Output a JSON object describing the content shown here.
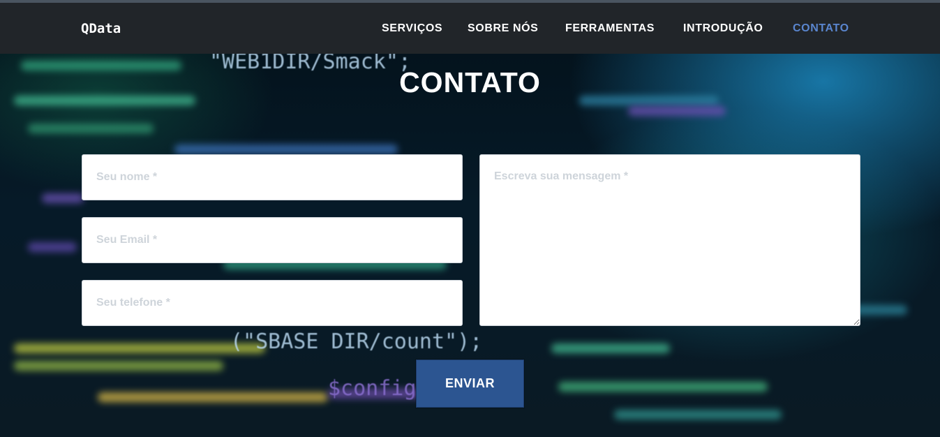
{
  "nav": {
    "brand": "QData",
    "links": [
      {
        "label": "SERVIÇOS"
      },
      {
        "label": "SOBRE NÓS"
      },
      {
        "label": "FERRAMENTAS"
      },
      {
        "label": "INTRODUÇÃO"
      },
      {
        "label": "CONTATO",
        "active": true
      }
    ]
  },
  "contact": {
    "title": "CONTATO",
    "name_placeholder": "Seu nome *",
    "email_placeholder": "Seu Email *",
    "phone_placeholder": "Seu telefone *",
    "message_placeholder": "Escreva sua mensagem *",
    "submit_label": "ENVIAR"
  },
  "colors": {
    "navbar": "#212529",
    "active_link": "#5a86cf",
    "button": "#2c5591"
  }
}
